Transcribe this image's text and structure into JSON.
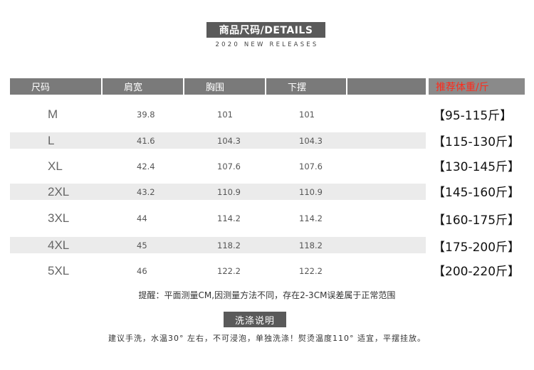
{
  "header": {
    "title": "商品尺码/DETAILS",
    "subtitle": "2020 NEW RELEASES"
  },
  "table": {
    "columns": [
      "尺码",
      "肩宽",
      "胸围",
      "下摆",
      "",
      "推荐体重/斤"
    ],
    "rows": [
      {
        "size": "M",
        "shoulder": "39.8",
        "chest": "101",
        "hem": "101",
        "weight": "【95-115斤】"
      },
      {
        "size": "L",
        "shoulder": "41.6",
        "chest": "104.3",
        "hem": "104.3",
        "weight": "【115-130斤】"
      },
      {
        "size": "XL",
        "shoulder": "42.4",
        "chest": "107.6",
        "hem": "107.6",
        "weight": "【130-145斤】"
      },
      {
        "size": "2XL",
        "shoulder": "43.2",
        "chest": "110.9",
        "hem": "110.9",
        "weight": "【145-160斤】"
      },
      {
        "size": "3XL",
        "shoulder": "44",
        "chest": "114.2",
        "hem": "114.2",
        "weight": "【160-175斤】"
      },
      {
        "size": "4XL",
        "shoulder": "45",
        "chest": "118.2",
        "hem": "118.2",
        "weight": "【175-200斤】"
      },
      {
        "size": "5XL",
        "shoulder": "46",
        "chest": "122.2",
        "hem": "122.2",
        "weight": "【200-220斤】"
      }
    ]
  },
  "note": "提醒：平面测量CM,因测量方法不同，存在2-3CM误差属于正常范围",
  "care": {
    "title": "洗涤说明",
    "text": "建议手洗，水温30° 左右，不可浸泡，单独洗涤！熨烫温度110° 适宜，平摆挂放。"
  },
  "colors": {
    "header_bg": "#7a7a7a",
    "recommend_text": "#ff2a1a",
    "shaded_row": "#ebebeb"
  }
}
